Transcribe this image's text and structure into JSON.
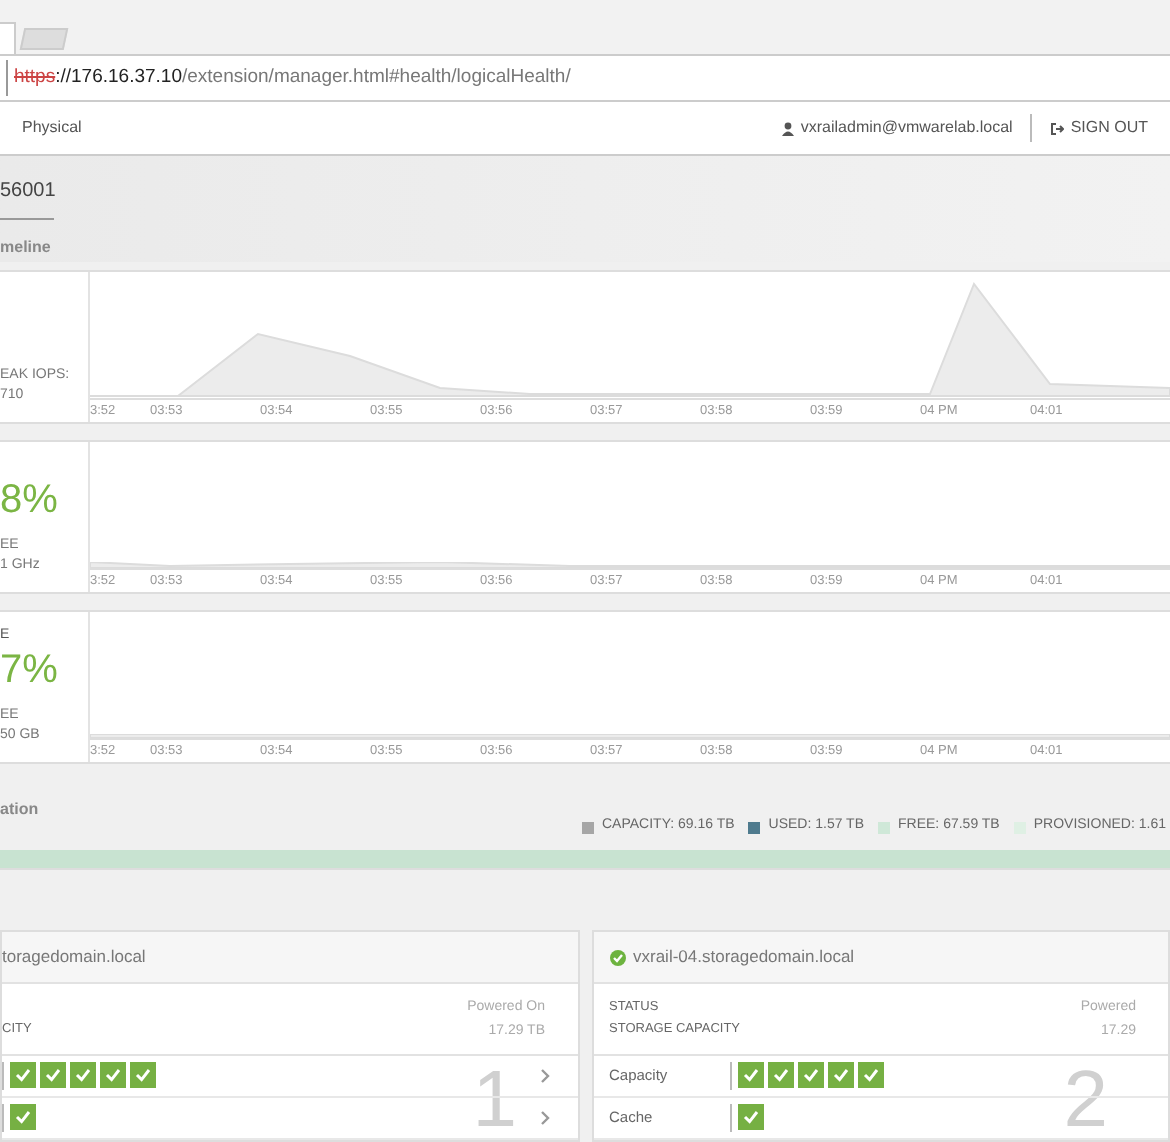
{
  "browser": {
    "address": {
      "scheme": "https",
      "host": "://176.16.37.10",
      "path": "/extension/manager.html#health/logicalHealth/"
    }
  },
  "nav": {
    "tab": "Physical",
    "user": "vxrailadmin@vmwarelab.local",
    "sign_out": "SIGN OUT"
  },
  "cluster": {
    "id": "56001",
    "section": "meline"
  },
  "panels": [
    {
      "kind": "iops",
      "lines": [
        "EAK IOPS:",
        "710"
      ],
      "time_labels": [
        "3:52",
        "03:53",
        "03:54",
        "03:55",
        "03:56",
        "03:57",
        "03:58",
        "03:59",
        "04 PM",
        "04:01"
      ]
    },
    {
      "kind": "cpu",
      "big": "8%",
      "lines": [
        "EE",
        "1 GHz"
      ],
      "time_labels": [
        "3:52",
        "03:53",
        "03:54",
        "03:55",
        "03:56",
        "03:57",
        "03:58",
        "03:59",
        "04 PM",
        "04:01"
      ]
    },
    {
      "kind": "storage",
      "top": "E",
      "big": "7%",
      "lines": [
        "EE",
        "50 GB"
      ],
      "time_labels": [
        "3:52",
        "03:53",
        "03:54",
        "03:55",
        "03:56",
        "03:57",
        "03:58",
        "03:59",
        "04 PM",
        "04:01"
      ]
    }
  ],
  "allocation": {
    "title": "ation",
    "legend": [
      {
        "label": "CAPACITY: 69.16 TB",
        "color": "#a6a6a6"
      },
      {
        "label": "USED: 1.57 TB",
        "color": "#4f7b8e"
      },
      {
        "label": "FREE: 67.59 TB",
        "color": "#cfe8d8"
      },
      {
        "label": "PROVISIONED: 1.61",
        "color": "#dff0e4"
      }
    ],
    "level": 1
  },
  "nodes": [
    {
      "title": "toragedomain.local",
      "healthy": false,
      "capacity_label": "CITY",
      "status": "Powered On",
      "capacity": "17.29 TB",
      "number": "1",
      "rows": [
        {
          "disks": [
            {
              "healthy": true
            },
            {
              "healthy": true
            },
            {
              "healthy": true
            },
            {
              "healthy": true
            },
            {
              "healthy": true
            }
          ],
          "expandable": true
        },
        {
          "disks": [
            {
              "healthy": true
            }
          ],
          "expandable": true
        }
      ]
    },
    {
      "title": "vxrail-04.storagedomain.local",
      "healthy": true,
      "status_label": "STATUS",
      "capacity_label": "STORAGE CAPACITY",
      "status": "Powered",
      "capacity": "17.29",
      "number": "2",
      "rows": [
        {
          "label": "Capacity",
          "disks": [
            {
              "healthy": true
            },
            {
              "healthy": true
            },
            {
              "healthy": true
            },
            {
              "healthy": true
            },
            {
              "healthy": true
            }
          ],
          "expandable": false
        },
        {
          "label": "Cache",
          "disks": [
            {
              "healthy": true
            }
          ],
          "expandable": false
        }
      ]
    }
  ]
}
